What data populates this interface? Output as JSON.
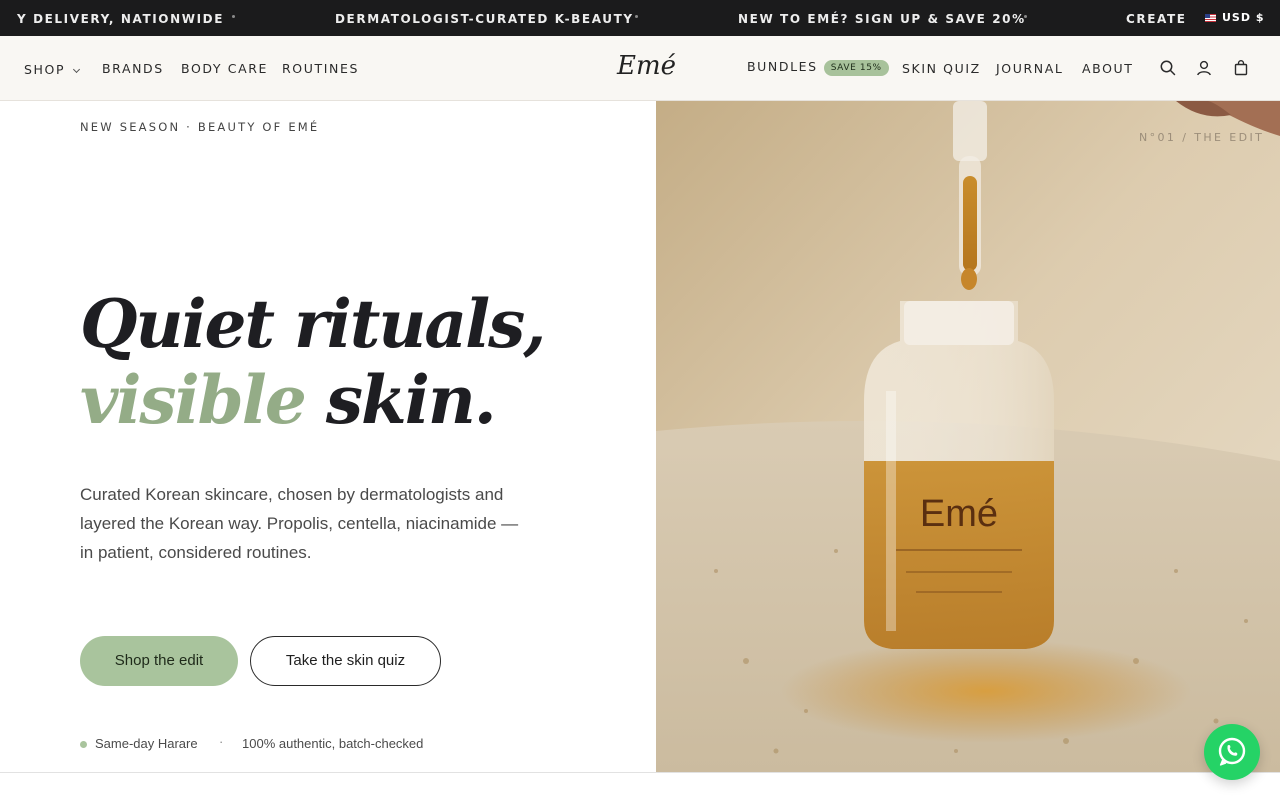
{
  "announcement": {
    "messages": [
      "Y DELIVERY, NATIONWIDE",
      "DERMATOLOGIST-CURATED K-BEAUTY",
      "NEW TO EMÉ? SIGN UP & SAVE 20%",
      "CREATE A"
    ],
    "currency": "USD $",
    "flag_icon": "us-flag-icon"
  },
  "header": {
    "nav_left": [
      "SHOP",
      "BRANDS",
      "BODY CARE",
      "ROUTINES"
    ],
    "logo": "Emé",
    "nav_right": {
      "bundles": "BUNDLES",
      "bundles_badge": "SAVE 15%",
      "skin_quiz": "SKIN QUIZ",
      "journal": "JOURNAL",
      "about": "ABOUT"
    },
    "icons": [
      "search-icon",
      "account-icon",
      "bag-icon"
    ]
  },
  "hero": {
    "eyebrow": "NEW SEASON · BEAUTY OF EMÉ",
    "headline_line1": "Quiet rituals,",
    "headline_accent": "visible",
    "headline_rest": "skin.",
    "subtext": "Curated Korean skincare, chosen by dermatologists and layered the Korean way. Propolis, centella, niacinamide — in patient, considered routines.",
    "primary_cta": "Shop the edit",
    "secondary_cta": "Take the skin quiz",
    "trust": [
      "Same-day Harare",
      "100% authentic, batch-checked"
    ],
    "trust_separator": "·",
    "image_tag": "N°01 / THE EDIT",
    "bottle_label": "Emé"
  },
  "colors": {
    "accent_green": "#a9c49d",
    "announcement_bg": "#1b1b1c",
    "header_bg": "#f9f7f3",
    "whatsapp_green": "#25d366"
  },
  "widgets": {
    "chat_icon": "whatsapp-icon"
  }
}
